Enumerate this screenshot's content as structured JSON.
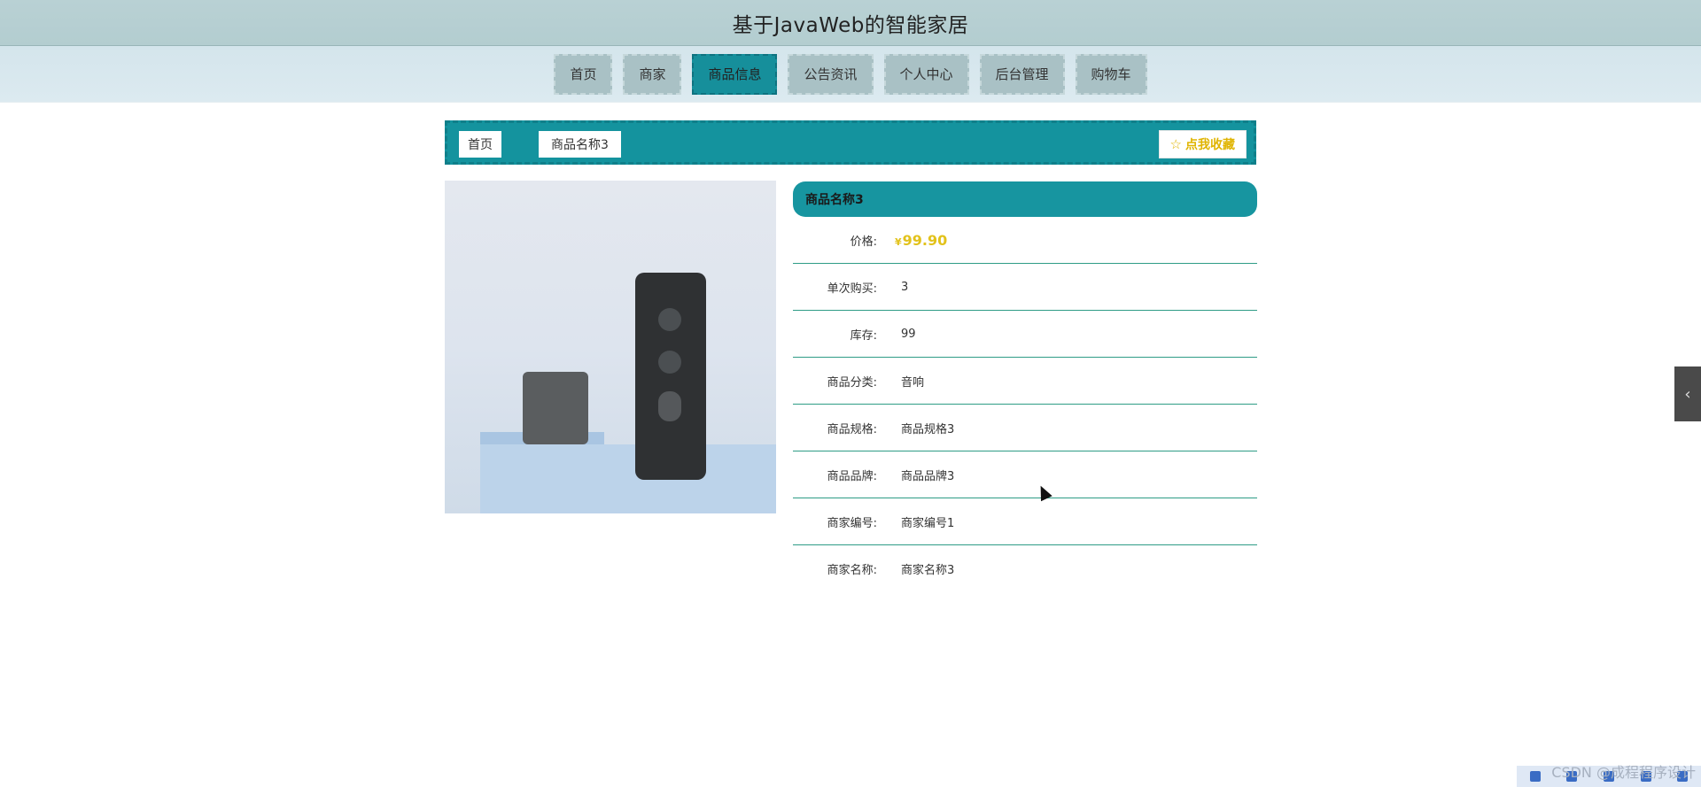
{
  "header": {
    "title": "基于JavaWeb的智能家居"
  },
  "nav": {
    "items": [
      {
        "label": "首页"
      },
      {
        "label": "商家"
      },
      {
        "label": "商品信息",
        "active": true
      },
      {
        "label": "公告资讯"
      },
      {
        "label": "个人中心"
      },
      {
        "label": "后台管理"
      },
      {
        "label": "购物车"
      }
    ]
  },
  "breadcrumb": {
    "home": "首页",
    "current": "商品名称3"
  },
  "favorite": {
    "label": "点我收藏",
    "icon": "star-outline-icon"
  },
  "product": {
    "title": "商品名称3",
    "price_symbol": "¥",
    "price": "99.90",
    "rows": [
      {
        "label": "价格:"
      },
      {
        "label": "单次购买:",
        "value": "3"
      },
      {
        "label": "库存:",
        "value": "99"
      },
      {
        "label": "商品分类:",
        "value": "音响"
      },
      {
        "label": "商品规格:",
        "value": "商品规格3"
      },
      {
        "label": "商品品牌:",
        "value": "商品品牌3"
      },
      {
        "label": "商家编号:",
        "value": "商家编号1"
      },
      {
        "label": "商家名称:",
        "value": "商家名称3"
      }
    ]
  },
  "side_toggle": {
    "icon": "chevron-left-icon",
    "glyph": "‹"
  },
  "watermark": "CSDN @成程程序设计",
  "colors": {
    "accent": "#14939e",
    "price": "#e2c21b",
    "favorite": "#e0b400"
  }
}
